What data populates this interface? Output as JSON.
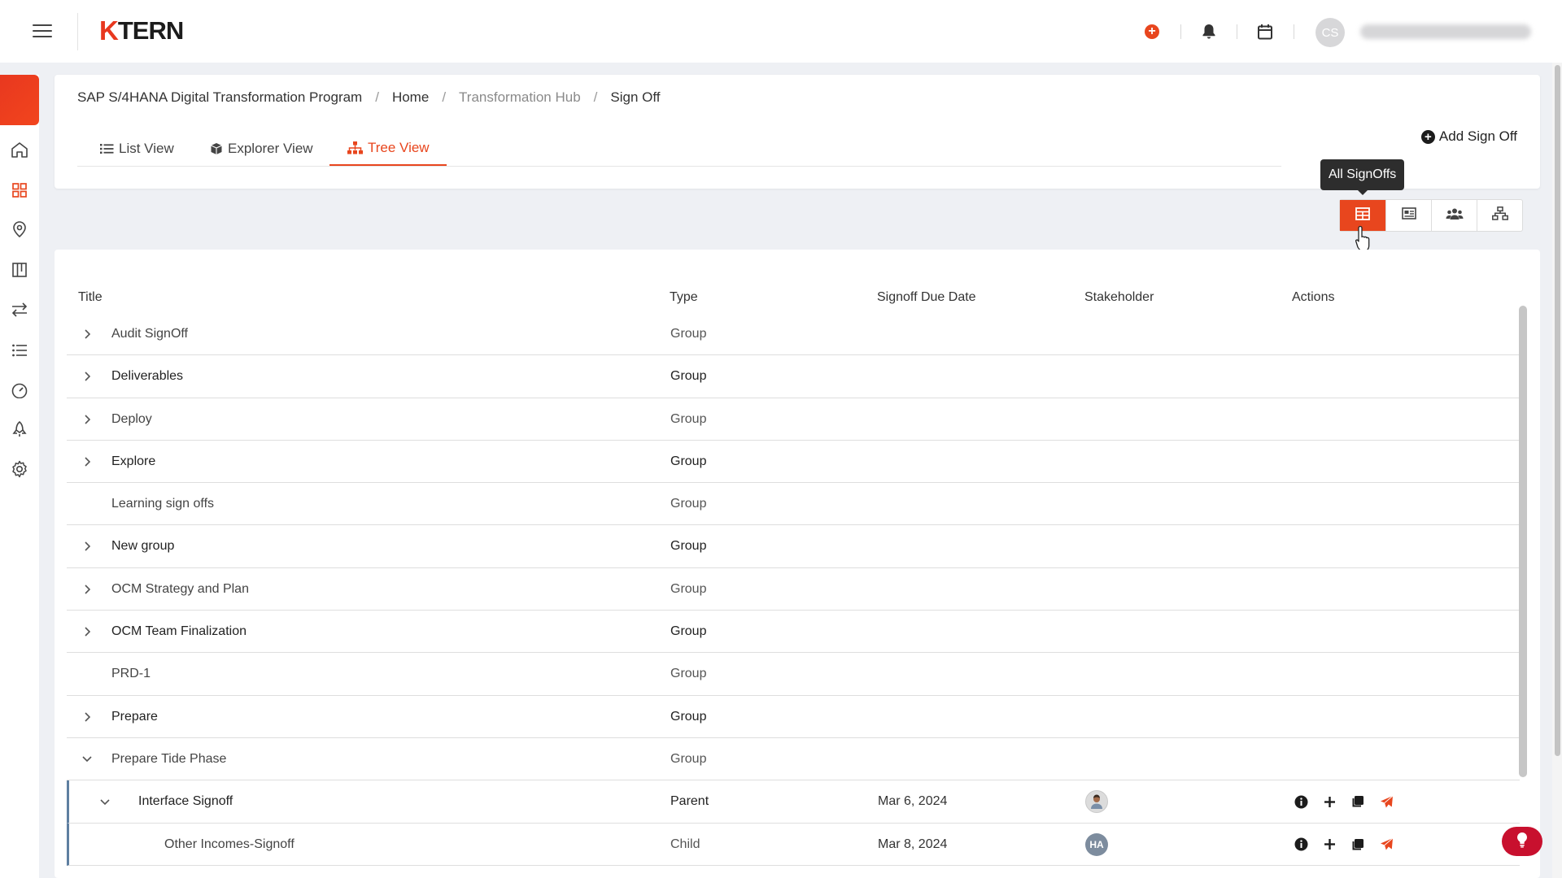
{
  "header": {
    "logo_k": "K",
    "logo_rest": "TERN",
    "avatar_initials": "CS",
    "icons": [
      "menu-icon",
      "add-circle-icon",
      "bell-icon",
      "calendar-icon"
    ],
    "accent": "#e8461e"
  },
  "sidebar": {
    "items": [
      "home-icon",
      "dashboard-grid-icon",
      "location-pin-icon",
      "kanban-board-icon",
      "transfer-arrows-icon",
      "list-icon",
      "speedometer-icon",
      "rocket-icon",
      "settings-gear-icon"
    ]
  },
  "breadcrumb": {
    "program": "SAP S/4HANA Digital Transformation Program",
    "home": "Home",
    "hub": "Transformation Hub",
    "current": "Sign Off",
    "separator": "/"
  },
  "tabs": {
    "list": "List View",
    "explorer": "Explorer View",
    "tree": "Tree View",
    "active": "Tree View"
  },
  "actions": {
    "add_signoff": "Add Sign Off"
  },
  "view_toggle": {
    "tooltip": "All SignOffs",
    "buttons": [
      "all-signoffs-table-icon",
      "card-view-icon",
      "stakeholder-group-icon",
      "hierarchy-icon"
    ]
  },
  "table": {
    "columns": {
      "title": "Title",
      "type": "Type",
      "due": "Signoff Due Date",
      "stakeholder": "Stakeholder",
      "actions": "Actions"
    },
    "rows": [
      {
        "title": "Audit SignOff",
        "type": "Group"
      },
      {
        "title": "Deliverables",
        "type": "Group"
      },
      {
        "title": "Deploy",
        "type": "Group"
      },
      {
        "title": "Explore",
        "type": "Group"
      },
      {
        "title": "Learning sign offs",
        "type": "Group"
      },
      {
        "title": "New group",
        "type": "Group"
      },
      {
        "title": "OCM Strategy and Plan",
        "type": "Group"
      },
      {
        "title": "OCM Team Finalization",
        "type": "Group"
      },
      {
        "title": "PRD-1",
        "type": "Group"
      },
      {
        "title": "Prepare",
        "type": "Group"
      },
      {
        "title": "Prepare Tide Phase",
        "type": "Group"
      },
      {
        "title": "Interface Signoff",
        "type": "Parent",
        "due": "Mar 6, 2024"
      },
      {
        "title": "Other Incomes-Signoff",
        "type": "Child",
        "due": "Mar 8, 2024",
        "stakeholder_initials": "HA"
      }
    ],
    "row_action_icons": [
      "info-icon",
      "add-icon",
      "copy-icon",
      "send-icon"
    ]
  }
}
